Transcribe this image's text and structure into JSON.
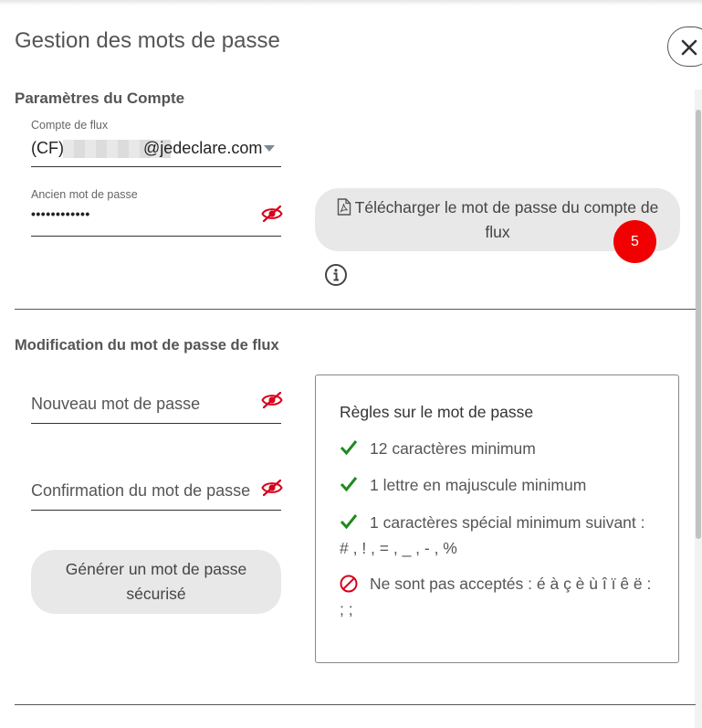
{
  "header": {
    "title": "Gestion des mots de passe"
  },
  "account_section": {
    "title": "Paramètres du Compte",
    "account_label": "Compte de flux",
    "account_prefix": "(CF)",
    "account_domain": "@jedeclare.com",
    "old_password_label": "Ancien mot de passe",
    "old_password_value": "••••••••••••",
    "download_label": "Télécharger le mot de passe du compte de flux",
    "badge": "5"
  },
  "change_section": {
    "title": "Modification du mot de passe de flux",
    "new_password_placeholder": "Nouveau mot de passe",
    "confirm_password_placeholder": "Confirmation du mot de passe",
    "generate_label": "Générer un mot de passe sécurisé"
  },
  "rules": {
    "title": "Règles sur le mot de passe",
    "items": [
      {
        "icon": "check-icon",
        "text": "12 caractères minimum"
      },
      {
        "icon": "check-icon",
        "text": "1 lettre en majuscule minimum"
      },
      {
        "icon": "check-icon",
        "text": "1 caractères spécial minimum suivant :",
        "text2": "# , ! , = , _ , - , %"
      },
      {
        "icon": "forbidden-icon",
        "text": "Ne sont pas acceptés : é à ç è ù î ï ê ë :",
        "text2": "; ;"
      }
    ]
  },
  "colors": {
    "accent_red": "#d9001b",
    "check_green": "#1f8a1f",
    "badge_red": "#f00000",
    "button_grey": "#e8e8e8"
  }
}
